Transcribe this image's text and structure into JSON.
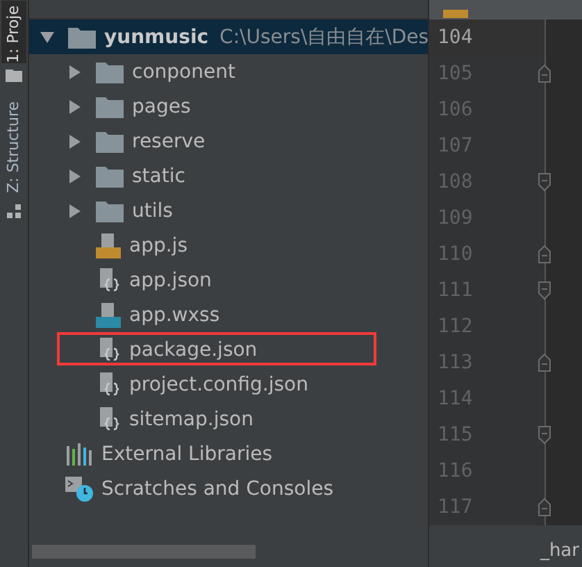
{
  "tool_strip": [
    {
      "label": "1: Proje",
      "selected": true
    },
    {
      "label": "Z: Structure",
      "selected": false
    }
  ],
  "project_tree": {
    "root": {
      "name": "yunmusic",
      "path": "C:\\Users\\自由自在\\Des",
      "expanded": true,
      "selected": true,
      "children": [
        {
          "name": "conponent",
          "kind": "folder",
          "expanded": false,
          "outlined": false
        },
        {
          "name": "pages",
          "kind": "folder",
          "expanded": false,
          "outlined": false
        },
        {
          "name": "reserve",
          "kind": "folder",
          "expanded": false,
          "outlined": false
        },
        {
          "name": "static",
          "kind": "folder",
          "expanded": false,
          "outlined": false
        },
        {
          "name": "utils",
          "kind": "folder",
          "expanded": false,
          "outlined": false
        },
        {
          "name": "app.js",
          "kind": "js",
          "outlined": false
        },
        {
          "name": "app.json",
          "kind": "json",
          "outlined": false
        },
        {
          "name": "app.wxss",
          "kind": "css",
          "outlined": false
        },
        {
          "name": "package.json",
          "kind": "json",
          "outlined": true
        },
        {
          "name": "project.config.json",
          "kind": "json",
          "outlined": false
        },
        {
          "name": "sitemap.json",
          "kind": "json",
          "outlined": false
        }
      ]
    },
    "extras": [
      {
        "name": "External Libraries",
        "kind": "libraries"
      },
      {
        "name": "Scratches and Consoles",
        "kind": "scratches"
      }
    ]
  },
  "editor": {
    "lines": [
      {
        "number": "104",
        "current": true,
        "kind": "plain"
      },
      {
        "number": "105",
        "current": false,
        "kind": "fold-start"
      },
      {
        "number": "106",
        "current": false,
        "kind": "plain"
      },
      {
        "number": "107",
        "current": false,
        "kind": "plain"
      },
      {
        "number": "108",
        "current": false,
        "kind": "fold-end"
      },
      {
        "number": "109",
        "current": false,
        "kind": "plain"
      },
      {
        "number": "110",
        "current": false,
        "kind": "fold-start"
      },
      {
        "number": "111",
        "current": false,
        "kind": "fold-end"
      },
      {
        "number": "112",
        "current": false,
        "kind": "plain"
      },
      {
        "number": "113",
        "current": false,
        "kind": "fold-start"
      },
      {
        "number": "114",
        "current": false,
        "kind": "plain"
      },
      {
        "number": "115",
        "current": false,
        "kind": "fold-end"
      },
      {
        "number": "116",
        "current": false,
        "kind": "plain"
      },
      {
        "number": "117",
        "current": false,
        "kind": "fold-start"
      }
    ],
    "breadcrumb": "_har"
  }
}
